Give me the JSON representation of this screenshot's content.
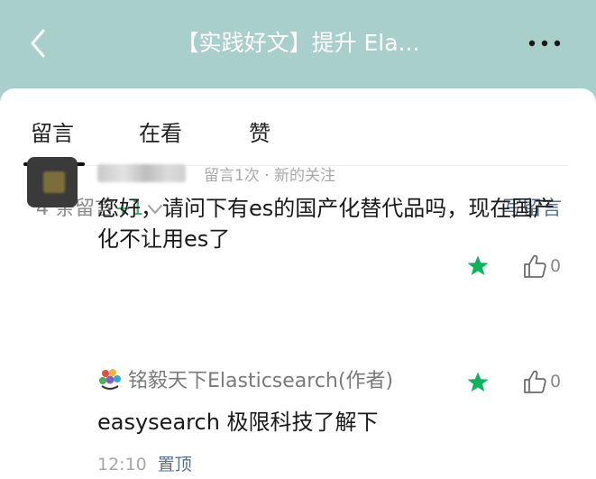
{
  "header": {
    "title": "【实践好文】提升 Ela...",
    "back_icon": "chevron-left-icon",
    "more_icon": "more-dots-icon",
    "background_color": "#a9cfcd"
  },
  "tabs": [
    {
      "label": "留言",
      "active": true
    },
    {
      "label": "在看",
      "active": false
    },
    {
      "label": "赞",
      "active": false
    }
  ],
  "comments_bar": {
    "count_text": "4 条留言",
    "new_badge": "+1",
    "write_label": "写留言"
  },
  "comment": {
    "meta": "留言1次 · 新的关注",
    "text": "您好，请问下有es的国产化替代品吗，现在国产化不让用es了",
    "likes": "0",
    "starred": true
  },
  "reply": {
    "author": "铭毅天下Elasticsearch(作者)",
    "text": "easysearch 极限科技了解下",
    "likes": "0",
    "starred": true,
    "time": "12:10",
    "pin_label": "置顶"
  },
  "colors": {
    "accent_green": "#3eb06a",
    "link_blue": "#56708f",
    "star_green": "#0bb45a"
  }
}
